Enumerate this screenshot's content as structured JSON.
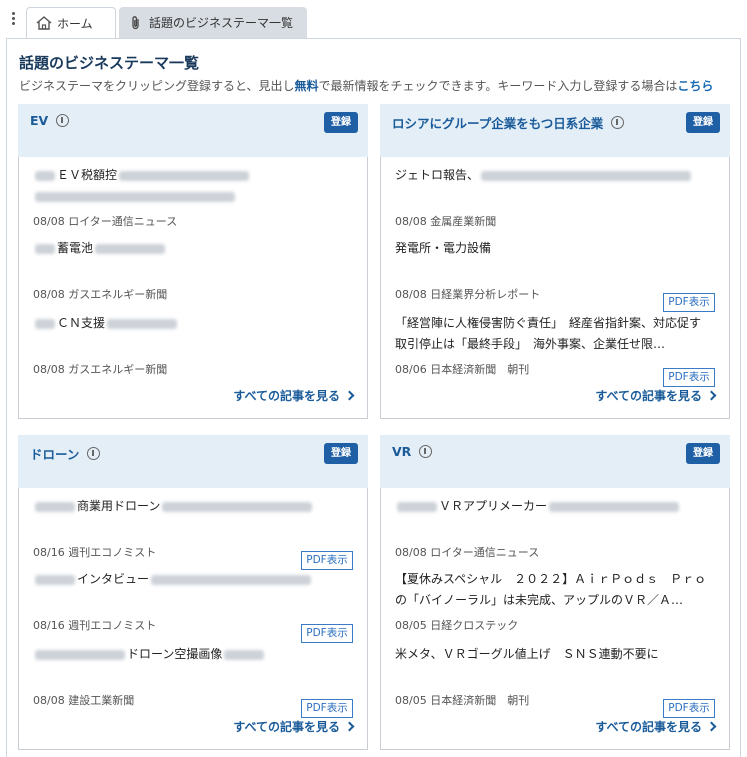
{
  "tabs": {
    "home": "ホーム",
    "active": "話題のビジネステーマ一覧"
  },
  "page": {
    "title": "話題のビジネステーマ一覧",
    "desc_before": "ビジネステーマをクリッピング登録すると、見出し",
    "desc_free": "無料",
    "desc_middle": "で最新情報をチェックできます。キーワード入力し登録する場合は",
    "desc_link": "こちら"
  },
  "register_label": "登録",
  "pdf_label": "PDF表示",
  "see_all_label": "すべての記事を見る",
  "cards": [
    {
      "name": "EV",
      "articles": [
        {
          "title": "ＥＶ税額控",
          "meta": "08/08 ロイター通信ニュース",
          "pdf": false
        },
        {
          "title": "蓄電池",
          "meta": "08/08 ガスエネルギー新聞",
          "pdf": false
        },
        {
          "title": "ＣＮ支援",
          "meta": "08/08 ガスエネルギー新聞",
          "pdf": false
        }
      ]
    },
    {
      "name": "ロシアにグループ企業をもつ日系企業",
      "articles": [
        {
          "title": "ジェトロ報告、",
          "meta": "08/08 金属産業新聞",
          "pdf": false
        },
        {
          "title": "発電所・電力設備",
          "meta": "08/08 日経業界分析レポート",
          "pdf": true
        },
        {
          "title": "「経営陣に人権侵害防ぐ責任」　経産省指針案、対応促す　取引停止は「最終手段」　海外事案、企業任せ限…",
          "meta": "08/06 日本経済新聞　朝刊",
          "pdf": true
        }
      ]
    },
    {
      "name": "ドローン",
      "articles": [
        {
          "title": "商業用ドローン",
          "meta": "08/16 週刊エコノミスト",
          "pdf": true
        },
        {
          "title": "インタビュー",
          "meta": "08/16 週刊エコノミスト",
          "pdf": true
        },
        {
          "title": "ドローン空撮画像",
          "meta": "08/08 建設工業新聞",
          "pdf": true
        }
      ]
    },
    {
      "name": "VR",
      "articles": [
        {
          "title": "ＶＲアプリメーカー",
          "meta": "08/08 ロイター通信ニュース",
          "pdf": false
        },
        {
          "title": "【夏休みスペシャル　２０２２】ＡｉｒＰｏｄｓ　Ｐｒｏの「バイノーラル」は未完成、アップルのＶＲ／Ａ…",
          "meta": "08/05 日経クロステック",
          "pdf": false
        },
        {
          "title": "米メタ、ＶＲゴーグル値上げ　ＳＮＳ連動不要に",
          "meta": "08/05 日本経済新聞　朝刊",
          "pdf": true
        }
      ]
    }
  ]
}
